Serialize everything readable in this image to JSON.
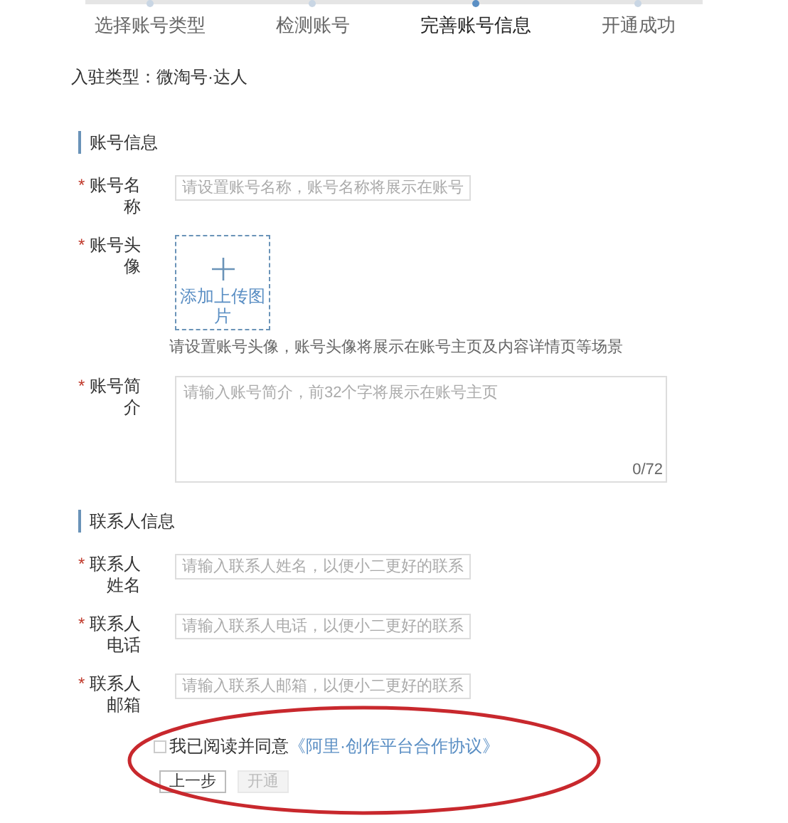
{
  "steps": [
    {
      "label": "选择账号类型",
      "selected": false
    },
    {
      "label": "检测账号",
      "selected": false
    },
    {
      "label": "完善账号信息",
      "selected": true
    },
    {
      "label": "开通成功",
      "selected": false
    }
  ],
  "account_type": "入驻类型：微淘号·达人",
  "sections": [
    {
      "title": "账号信息",
      "fields": [
        {
          "kind": "input",
          "required": "*",
          "label": "账号名称",
          "placeholder": "请设置账号名称，账号名称将展示在账号"
        },
        {
          "kind": "upload",
          "required": "*",
          "label": "账号头像",
          "button": "添加上传图片",
          "hint": "请设置账号头像，账号头像将展示在账号主页及内容详情页等场景"
        },
        {
          "kind": "textarea",
          "required": "*",
          "label": "账号简介",
          "placeholder": "请输入账号简介，前32个字将展示在账号主页",
          "counter": "0/72"
        }
      ]
    },
    {
      "title": "联系人信息",
      "fields": [
        {
          "kind": "input",
          "required": "*",
          "label": "联系人姓名",
          "placeholder": "请输入联系人姓名，以便小二更好的联系"
        },
        {
          "kind": "input",
          "required": "*",
          "label": "联系人电话",
          "placeholder": "请输入联系人电话，以便小二更好的联系"
        },
        {
          "kind": "input",
          "required": "*",
          "label": "联系人邮箱",
          "placeholder": "请输入联系人邮箱，以便小二更好的联系"
        }
      ]
    }
  ],
  "agreement": {
    "checked": false,
    "text": "我已阅读并同意",
    "link": "《阿里·创作平台合作协议》"
  },
  "buttons": [
    {
      "label": "上一步",
      "disabled": false
    },
    {
      "label": "开通",
      "disabled": true
    }
  ]
}
